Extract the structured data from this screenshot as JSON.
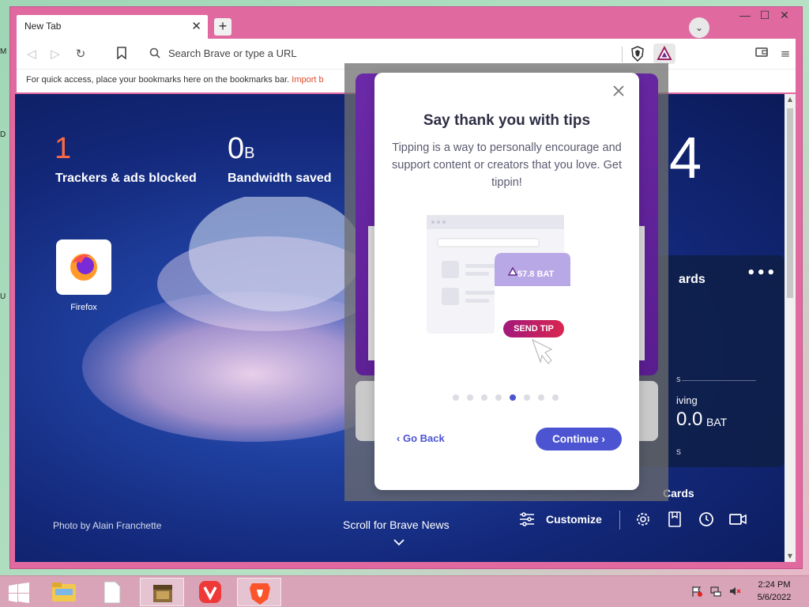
{
  "tab": {
    "title": "New Tab",
    "close": "✕"
  },
  "toolbar": {
    "url_placeholder": "Search Brave or type a URL"
  },
  "bookmarks_bar": {
    "text": "For quick access, place your bookmarks here on the bookmarks bar.",
    "import_link": "Import b"
  },
  "window_controls": {
    "minimize": "—",
    "maximize": "☐",
    "close": "✕"
  },
  "newtab": {
    "stats": [
      {
        "value": "1",
        "unit": "",
        "label": "Trackers & ads blocked",
        "color": "#ff6a45"
      },
      {
        "value": "0",
        "unit": "B",
        "label": "Bandwidth saved",
        "color": "#ffffff"
      }
    ],
    "clock": "4",
    "top_site": {
      "label": "Firefox"
    },
    "rewards_card": {
      "title": "ards",
      "more": "•••",
      "s_label": "s",
      "giving_label": "iving",
      "amount": "0.0",
      "currency": "BAT",
      "s2_label": "s"
    },
    "cards_label": "Cards",
    "photo_credit": "Photo by Alain Franchette",
    "scroll_news": "Scroll for Brave News",
    "customize": "Customize"
  },
  "onboarding": {
    "title": "Say thank you with tips",
    "body": "Tipping is a way to personally encourage and support content or creators that you love. Get tippin!",
    "illustration": {
      "bat_amount": "57.8 BAT",
      "send_tip": "SEND TIP"
    },
    "step_count": 8,
    "active_step": 5,
    "go_back": "Go Back",
    "continue": "Continue"
  },
  "taskbar": {
    "time": "2:24 PM",
    "date": "5/6/2022"
  },
  "desktop_marks": [
    "M",
    "D",
    "U"
  ],
  "colors": {
    "accent": "#4c54d2",
    "brave_orange": "#ff6a45",
    "window_frame": "#e06aa0"
  }
}
